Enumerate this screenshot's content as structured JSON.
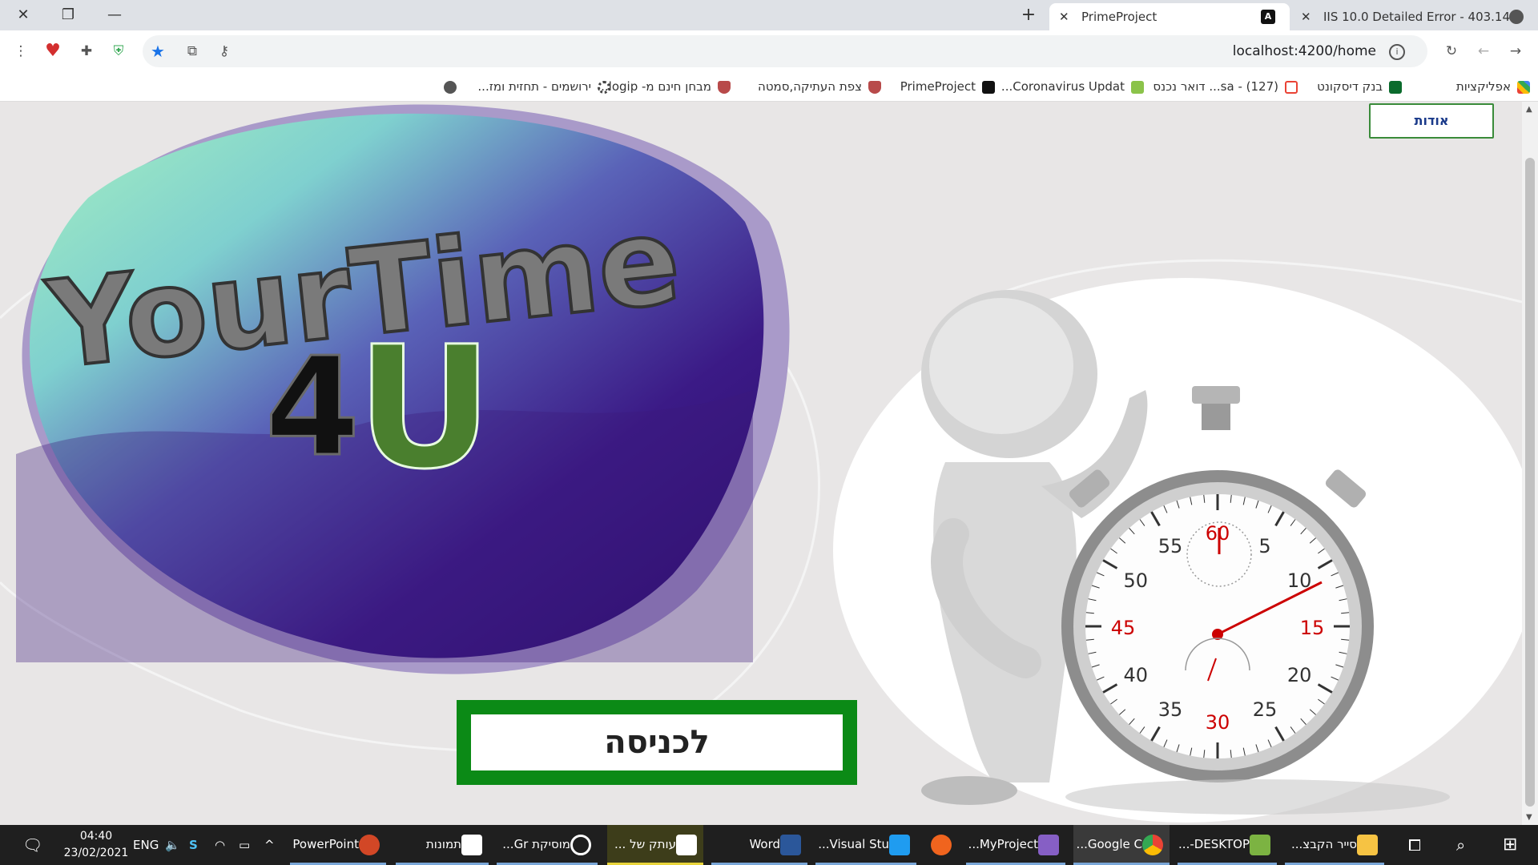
{
  "browser": {
    "tabs": [
      {
        "title": "PrimeProject",
        "active": true,
        "favicon": "angular-icon"
      },
      {
        "title": "IIS 10.0 Detailed Error - 403.14 -",
        "active": false,
        "favicon": "globe-icon"
      }
    ],
    "url": "localhost:4200/home",
    "bookmarks": [
      {
        "label": "אפליקציות",
        "icon": "apps-grid-icon"
      },
      {
        "label": "בנק דיסקונט",
        "icon": "bank-icon"
      },
      {
        "label": "(127) - sa... דואר נכנס",
        "icon": "gmail-icon"
      },
      {
        "label": "Coronavirus Updat...",
        "icon": "w-icon"
      },
      {
        "label": "PrimeProject",
        "icon": "angular-icon"
      },
      {
        "label": "צפת העתיקה,סמטה",
        "icon": "shield-icon"
      },
      {
        "label": "מבחן חינם מ- logip...",
        "icon": "shield-icon"
      },
      {
        "label": "ירושמים - תחזית ומז...",
        "icon": "gear-icon"
      }
    ]
  },
  "page": {
    "about_label": "אודות",
    "enter_label": "לכניסה",
    "logo": {
      "line1": "YourTime",
      "line2_digit": "4",
      "line2_letter": "U"
    },
    "stopwatch_numbers": [
      "60",
      "5",
      "10",
      "15",
      "20",
      "25",
      "30",
      "35",
      "40",
      "45",
      "50",
      "55"
    ]
  },
  "taskbar": {
    "time": "04:40",
    "date": "23/02/2021",
    "lang": "ENG",
    "apps": [
      {
        "label": "סייר הקבצ...",
        "icon": "folder-icon"
      },
      {
        "label": "DESKTOP-...",
        "icon": "remote-icon"
      },
      {
        "label": "Google C...",
        "icon": "chrome-icon"
      },
      {
        "label": "MyProject...",
        "icon": "visual-studio-icon"
      },
      {
        "label": "",
        "icon": "app-orange-icon"
      },
      {
        "label": "Visual Stu...",
        "icon": "vscode-icon"
      },
      {
        "label": "Word",
        "icon": "word-icon"
      },
      {
        "label": "עותק של ...",
        "icon": "movie-maker-icon"
      },
      {
        "label": "מוסיקת Gr...",
        "icon": "music-icon"
      },
      {
        "label": "תמונות",
        "icon": "photos-icon"
      },
      {
        "label": "PowerPoint",
        "icon": "powerpoint-icon"
      }
    ]
  },
  "colors": {
    "accent_green": "#0b8a16",
    "logo_purple": "#3b1a7a",
    "logo_u_green": "#4a7f2e",
    "about_text": "#1a3a8a"
  }
}
